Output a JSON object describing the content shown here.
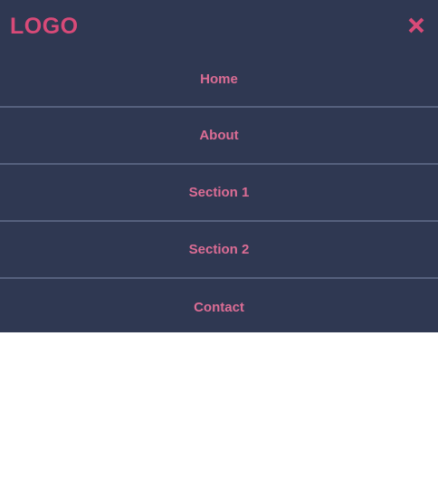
{
  "brand": {
    "logo_text": "LOGO",
    "accent_color": "#d84a78"
  },
  "header": {
    "close_icon": "close-icon"
  },
  "nav": {
    "items": [
      {
        "label": "Home"
      },
      {
        "label": "About"
      },
      {
        "label": "Section 1"
      },
      {
        "label": "Section 2"
      },
      {
        "label": "Contact"
      }
    ]
  },
  "colors": {
    "panel_background": "#2f3852",
    "divider": "#55607d",
    "link_text": "#dc6d95",
    "page_background": "#ffffff"
  }
}
